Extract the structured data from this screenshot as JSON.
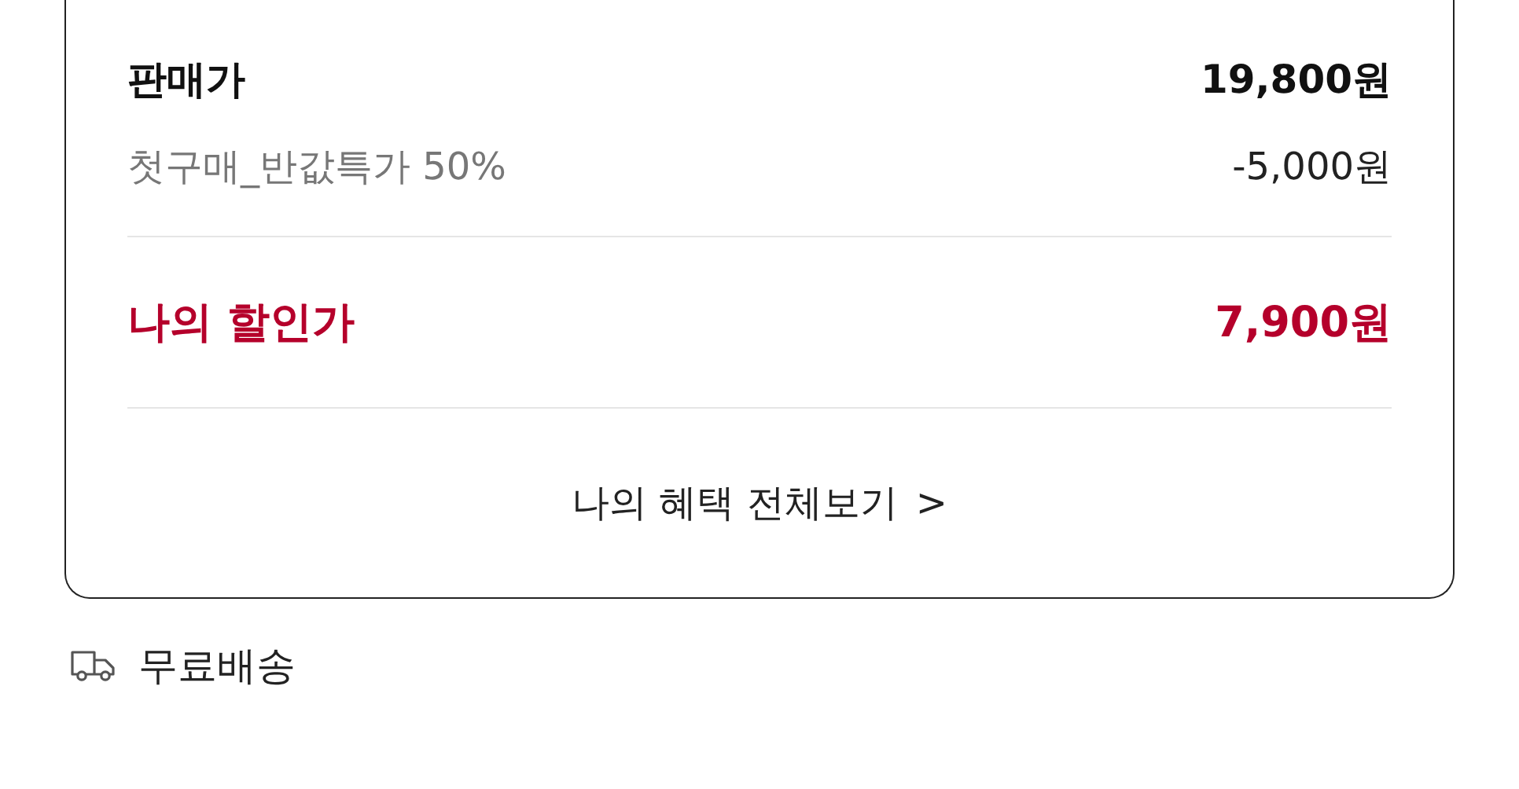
{
  "price_card": {
    "rows": [
      {
        "kind": "price",
        "label": "판매가",
        "amount": "19,800원"
      },
      {
        "kind": "discount",
        "label": "첫구매_반값특가 50%",
        "amount": "-5,000원"
      },
      {
        "kind": "total",
        "label": "나의 할인가",
        "amount": "7,900원"
      }
    ],
    "link": {
      "label": "나의 혜택 전체보기",
      "chevron": ">"
    }
  },
  "shipping": {
    "label": "무료배송"
  }
}
